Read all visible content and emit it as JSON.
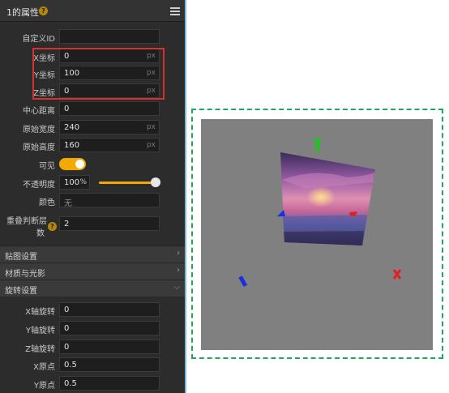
{
  "panel": {
    "title": "1的属性",
    "help_glyph": "?",
    "custom_id_label": "自定义ID",
    "custom_id_value": "",
    "x_label": "X坐标",
    "x_value": "0",
    "x_unit": "px",
    "y_label": "Y坐标",
    "y_value": "100",
    "y_unit": "px",
    "z_label": "Z坐标",
    "z_value": "0",
    "z_unit": "px",
    "center_dist_label": "中心距离",
    "center_dist_value": "0",
    "orig_width_label": "原始宽度",
    "orig_width_value": "240",
    "orig_width_unit": "px",
    "orig_height_label": "原始高度",
    "orig_height_value": "160",
    "orig_height_unit": "px",
    "visible_label": "可见",
    "visible": true,
    "opacity_label": "不透明度",
    "opacity_value": "100",
    "opacity_unit": "%",
    "opacity_level": 1.0,
    "color_label": "颜色",
    "color_value": "无",
    "overlap_label_line1": "重叠判断层",
    "overlap_label_line2": "数",
    "overlap_value": "2"
  },
  "sections": {
    "texture": "贴图设置",
    "material": "材质与光影",
    "rotation": "旋转设置"
  },
  "rotation": {
    "x_rot_label": "X轴旋转",
    "x_rot_value": "0",
    "y_rot_label": "Y轴旋转",
    "y_rot_value": "0",
    "z_rot_label": "Z轴旋转",
    "z_rot_value": "0",
    "x_origin_label": "X原点",
    "x_origin_value": "0.5",
    "y_origin_label": "Y原点",
    "y_origin_value": "0.5"
  },
  "colors": {
    "accent": "#f2a900",
    "highlight_box": "#d63030",
    "canvas_border": "#1ea85a",
    "axis_x": "#e02020",
    "axis_y": "#22c022",
    "axis_z": "#1530e0"
  },
  "icons": {
    "menu": "hamburger-menu-icon",
    "chevron_right": "chevron-right-icon",
    "chevron_down": "chevron-down-icon"
  }
}
